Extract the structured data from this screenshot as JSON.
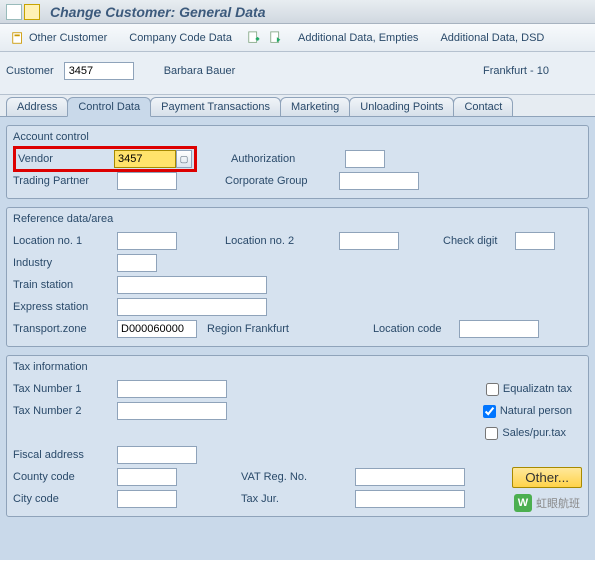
{
  "title": "Change Customer: General Data",
  "toolbar": {
    "other_customer": "Other Customer",
    "company_code": "Company Code Data",
    "additional_empties": "Additional Data, Empties",
    "additional_dsd": "Additional Data, DSD"
  },
  "selection": {
    "customer_label": "Customer",
    "customer_value": "3457",
    "customer_name": "Barbara Bauer",
    "customer_city": "Frankfurt - 10"
  },
  "tabs": {
    "address": "Address",
    "control_data": "Control Data",
    "payment": "Payment Transactions",
    "marketing": "Marketing",
    "unloading": "Unloading Points",
    "contact": "Contact"
  },
  "account_control": {
    "title": "Account control",
    "vendor_label": "Vendor",
    "vendor_value": "3457",
    "auth_label": "Authorization",
    "auth_value": "",
    "trading_label": "Trading Partner",
    "trading_value": "",
    "corp_label": "Corporate Group",
    "corp_value": ""
  },
  "reference": {
    "title": "Reference data/area",
    "loc1_label": "Location no. 1",
    "loc1_value": "",
    "loc2_label": "Location no. 2",
    "loc2_value": "",
    "check_label": "Check digit",
    "check_value": "",
    "industry_label": "Industry",
    "industry_value": "",
    "train_label": "Train station",
    "train_value": "",
    "express_label": "Express station",
    "express_value": "",
    "tzone_label": "Transport.zone",
    "tzone_value": "D000060000",
    "tzone_text": "Region Frankfurt",
    "loccode_label": "Location code",
    "loccode_value": ""
  },
  "tax": {
    "title": "Tax information",
    "tax1_label": "Tax Number 1",
    "tax1_value": "",
    "tax2_label": "Tax Number 2",
    "tax2_value": "",
    "eq_label": "Equalizatn tax",
    "eq_checked": false,
    "np_label": "Natural person",
    "np_checked": true,
    "sp_label": "Sales/pur.tax",
    "sp_checked": false,
    "fa_label": "Fiscal address",
    "fa_value": "",
    "county_label": "County code",
    "county_value": "",
    "vat_label": "VAT Reg. No.",
    "vat_value": "",
    "other_btn": "Other...",
    "city_label": "City code",
    "city_value": "",
    "taxjur_label": "Tax Jur.",
    "taxjur_value": ""
  },
  "watermark": "虹眼航班"
}
